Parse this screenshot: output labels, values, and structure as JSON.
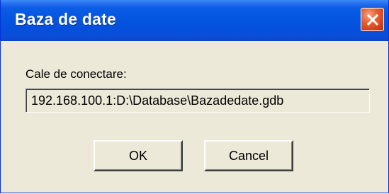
{
  "window": {
    "title": "Baza de date"
  },
  "form": {
    "connection_label": "Cale de conectare:",
    "connection_value": "192.168.100.1:D:\\Database\\Bazadedate.gdb"
  },
  "buttons": {
    "ok_label": "OK",
    "cancel_label": "Cancel"
  },
  "icons": {
    "close": "close-icon"
  },
  "colors": {
    "titlebar": "#0455e0",
    "close_button": "#e4602f",
    "dialog_background": "#ece9d8"
  }
}
